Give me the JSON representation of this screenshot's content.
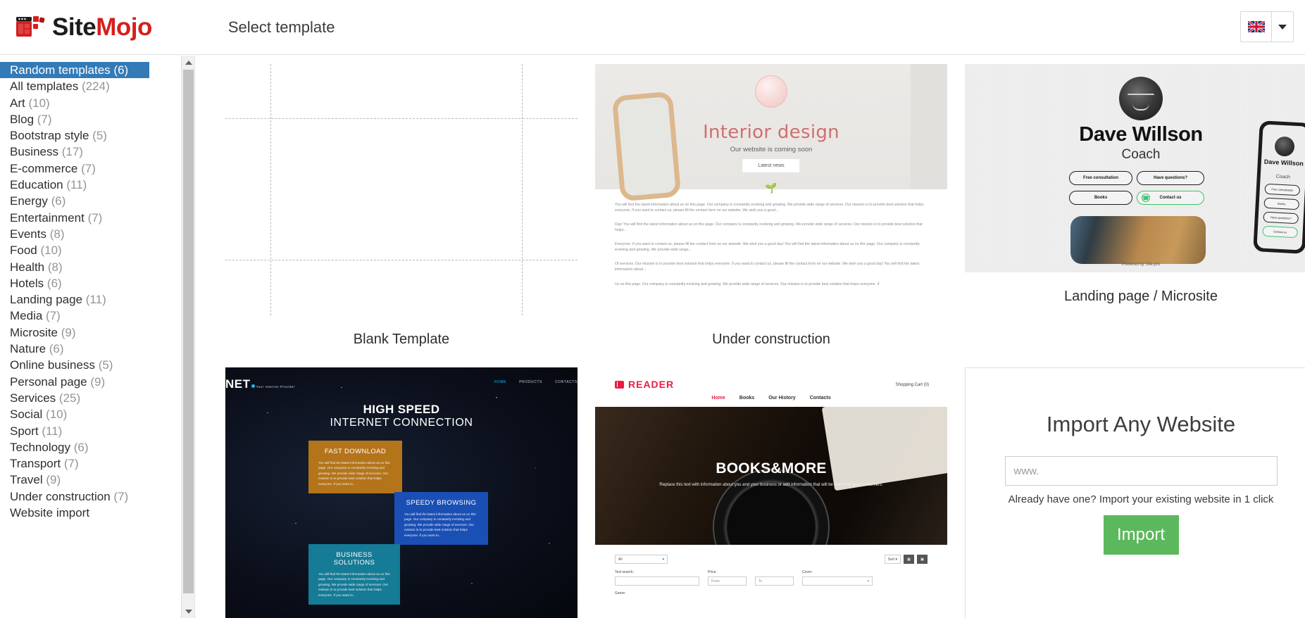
{
  "brand": {
    "name_part1": "Site",
    "name_part2": "Mojo",
    "logo_icon": "sitemojo-browser-logo-icon"
  },
  "header": {
    "title": "Select template",
    "language": {
      "flag": "united-kingdom-flag-icon",
      "caret": "chevron-down-icon"
    }
  },
  "sidebar": {
    "scroll_up_icon": "scroll-arrow-up-icon",
    "scroll_down_icon": "scroll-arrow-down-icon",
    "items": [
      {
        "label": "Random templates",
        "count": "(6)",
        "active": true
      },
      {
        "label": "All templates",
        "count": "(224)",
        "active": false
      },
      {
        "label": "Art",
        "count": "(10)",
        "active": false
      },
      {
        "label": "Blog",
        "count": "(7)",
        "active": false
      },
      {
        "label": "Bootstrap style",
        "count": "(5)",
        "active": false
      },
      {
        "label": "Business",
        "count": "(17)",
        "active": false
      },
      {
        "label": "E-commerce",
        "count": "(7)",
        "active": false
      },
      {
        "label": "Education",
        "count": "(11)",
        "active": false
      },
      {
        "label": "Energy",
        "count": "(6)",
        "active": false
      },
      {
        "label": "Entertainment",
        "count": "(7)",
        "active": false
      },
      {
        "label": "Events",
        "count": "(8)",
        "active": false
      },
      {
        "label": "Food",
        "count": "(10)",
        "active": false
      },
      {
        "label": "Health",
        "count": "(8)",
        "active": false
      },
      {
        "label": "Hotels",
        "count": "(6)",
        "active": false
      },
      {
        "label": "Landing page",
        "count": "(11)",
        "active": false
      },
      {
        "label": "Media",
        "count": "(7)",
        "active": false
      },
      {
        "label": "Microsite",
        "count": "(9)",
        "active": false
      },
      {
        "label": "Nature",
        "count": "(6)",
        "active": false
      },
      {
        "label": "Online business",
        "count": "(5)",
        "active": false
      },
      {
        "label": "Personal page",
        "count": "(9)",
        "active": false
      },
      {
        "label": "Services",
        "count": "(25)",
        "active": false
      },
      {
        "label": "Social",
        "count": "(10)",
        "active": false
      },
      {
        "label": "Sport",
        "count": "(11)",
        "active": false
      },
      {
        "label": "Technology",
        "count": "(6)",
        "active": false
      },
      {
        "label": "Transport",
        "count": "(7)",
        "active": false
      },
      {
        "label": "Travel",
        "count": "(9)",
        "active": false
      },
      {
        "label": "Under construction",
        "count": "(7)",
        "active": false
      },
      {
        "label": "Website import",
        "count": "",
        "active": false
      }
    ]
  },
  "templates": {
    "blank": {
      "caption": "Blank Template"
    },
    "under_construction": {
      "caption": "Under construction",
      "hero_title": "Interior design",
      "hero_subtitle": "Our website is coming soon",
      "hero_button": "Latest news",
      "paragraphs": [
        "You will find the latest information about us on this page. Our company is constantly evolving and growing. We provide wide range of services. Our mission is to provide best solution that helps everyone. If you want to contact us, please fill the contact form on our website. We wish you a good...",
        "Day! You will find the latest information about us on this page. Our company is constantly evolving and growing. We provide wide range of services. Our mission is to provide best solution that helps...",
        "Everyone. If you want to contact us, please fill the contact form on our website. We wish you a good day! You will find the latest information about us on this page. Our company is constantly evolving and growing. We provide wide range...",
        "Of services. Our mission is to provide best solution that helps everyone. If you want to contact us, please fill the contact form on our website. We wish you a good day! You will find the latest information about...",
        "Us on this page. Our company is constantly evolving and growing. We provide wide range of services. Our mission is to provide best solution that helps everyone. If"
      ]
    },
    "landing_microsite": {
      "caption": "Landing page / Microsite",
      "name": "Dave Willson",
      "role": "Coach",
      "buttons": [
        "Free consultation",
        "Have questions?",
        "Books",
        "Contact us"
      ],
      "whatsapp_icon": "whatsapp-icon",
      "powered_by": "Powered by",
      "powered_brand": "Site.pro",
      "phone_buttons": [
        "Free consultation",
        "Books",
        "Have questions?",
        "Contact us"
      ]
    },
    "net": {
      "logo": "NET",
      "logo_tagline": "Your Internet Provider",
      "nav": [
        "HOME",
        "PRODUCTS",
        "CONTACTS"
      ],
      "headline_line1": "HIGH SPEED",
      "headline_line2": "INTERNET CONNECTION",
      "cards": [
        {
          "title": "FAST DOWNLOAD",
          "body": "You will find the latest information about us on this page. Our company is constantly evolving and growing. We provide wide range of services. Our mission is to provide best solution that helps everyone. If you want to...",
          "color": "#b4741a"
        },
        {
          "title": "SPEEDY BROWSING",
          "body": "You will find the latest information about us on this page. Our company is constantly evolving and growing. We provide wide range of services. Our mission is to provide best solution that helps everyone. If you want to...",
          "color": "#1a4fb5"
        },
        {
          "title": "BUSINESS SOLUTIONS",
          "body": "You will find the latest information about us on this page. Our company is constantly evolving and growing. We provide wide range of services. Our mission is to provide best solution that helps everyone. If you want to...",
          "color": "#157b96"
        }
      ]
    },
    "reader": {
      "logo": "READER",
      "logo_icon": "book-icon",
      "cart": "Shopping Cart (0)",
      "nav": [
        "Home",
        "Books",
        "Our History",
        "Contacts"
      ],
      "hero_title": "BOOKS&MORE",
      "hero_subtitle": "Replace this text with information about you and your business or add information that will be useful for your customers.",
      "filter_select": "All",
      "sort_label": "Sort",
      "grid_view_icon": "grid-view-icon",
      "list_view_icon": "list-view-icon",
      "fields": [
        {
          "label": "Text search:",
          "placeholder": ""
        },
        {
          "label": "Price:",
          "placeholder": "From"
        },
        {
          "label": "",
          "placeholder": "To"
        },
        {
          "label": "Cover:",
          "placeholder": ""
        }
      ],
      "genre_label": "Genre:"
    },
    "import": {
      "title": "Import Any Website",
      "input_placeholder": "www.",
      "hint": "Already have one? Import your existing website in 1 click",
      "button": "Import"
    }
  },
  "colors": {
    "accent_blue": "#337ab7",
    "brand_red": "#d32020",
    "import_green": "#5cb85c"
  }
}
